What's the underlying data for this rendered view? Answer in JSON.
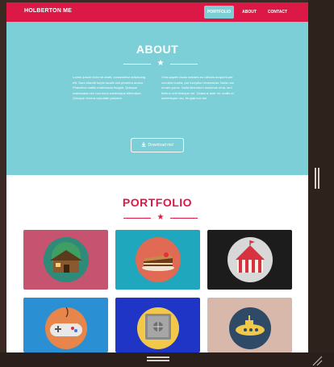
{
  "nav": {
    "brand": "HOLBERTON ME",
    "links": [
      "PORTFOLIO",
      "ABOUT",
      "CONTACT"
    ],
    "active": "PORTFOLIO"
  },
  "about": {
    "title": "ABOUT",
    "left_text": "Lorem ipsum dolor sit amet, consectetur adipiscing elit. Nam blandit turpis iaculis nisl pharetra auctor. Phasellus mattis malesuada feugiat. Quisque malesuada orci non risus scelerisque bibendum. Quisque viverra vulputate posuere.",
    "right_text": "Cras sapien lacus sodales eu ultrices torquent per conubia nostra, per inceptos himenaeos. Nulla non ornare purus. Nulla bibendum maximus urna, sed finibus velit tristique vel. Vivamus ante mi, mollis et scelerisque nec, feugiat non dui.",
    "download_label": "Download me!"
  },
  "portfolio": {
    "title": "PORTFOLIO",
    "items": [
      {
        "name": "cabin",
        "bg": "#c65370",
        "icon": "cabin-icon"
      },
      {
        "name": "cake",
        "bg": "#1fa7be",
        "icon": "cake-icon"
      },
      {
        "name": "circus",
        "bg": "#1c1c1c",
        "icon": "circus-tent-icon"
      },
      {
        "name": "game",
        "bg": "#2b8fd3",
        "icon": "game-controller-icon"
      },
      {
        "name": "safe",
        "bg": "#1f35c6",
        "icon": "safe-icon"
      },
      {
        "name": "submarine",
        "bg": "#d7b8ab",
        "icon": "submarine-icon"
      }
    ]
  },
  "colors": {
    "primary": "#dc1847",
    "about_bg": "#7ccfd6",
    "active_nav": "#7ecfd4"
  }
}
